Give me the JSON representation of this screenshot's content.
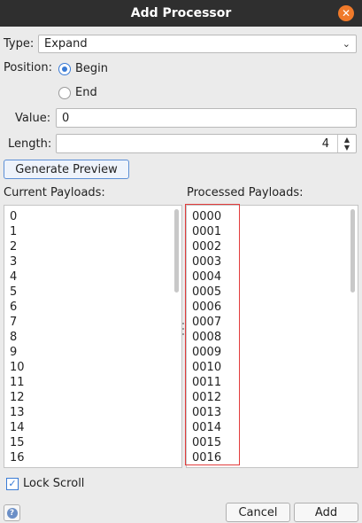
{
  "window": {
    "title": "Add Processor"
  },
  "type_field": {
    "label": "Type:",
    "value": "Expand"
  },
  "position": {
    "label": "Position:",
    "options": [
      {
        "label": "Begin",
        "selected": true
      },
      {
        "label": "End",
        "selected": false
      }
    ]
  },
  "value_field": {
    "label": "Value:",
    "value": "0"
  },
  "length_field": {
    "label": "Length:",
    "value": "4"
  },
  "generate_button": "Generate Preview",
  "current_payloads": {
    "label": "Current Payloads:",
    "items": [
      "0",
      "1",
      "2",
      "3",
      "4",
      "5",
      "6",
      "7",
      "8",
      "9",
      "10",
      "11",
      "12",
      "13",
      "14",
      "15",
      "16"
    ]
  },
  "processed_payloads": {
    "label": "Processed Payloads:",
    "items": [
      "0000",
      "0001",
      "0002",
      "0003",
      "0004",
      "0005",
      "0006",
      "0007",
      "0008",
      "0009",
      "0010",
      "0011",
      "0012",
      "0013",
      "0014",
      "0015",
      "0016"
    ]
  },
  "lock_scroll": {
    "label": "Lock Scroll",
    "checked": true
  },
  "footer": {
    "cancel": "Cancel",
    "add": "Add"
  },
  "colors": {
    "accent": "#3a7bd5",
    "close": "#f07a2a",
    "highlight": "#e23c3c",
    "titlebar": "#2f2f2f"
  },
  "icons": {
    "close": "close-icon",
    "help": "help-icon",
    "dropdown": "chevron-down-icon"
  }
}
